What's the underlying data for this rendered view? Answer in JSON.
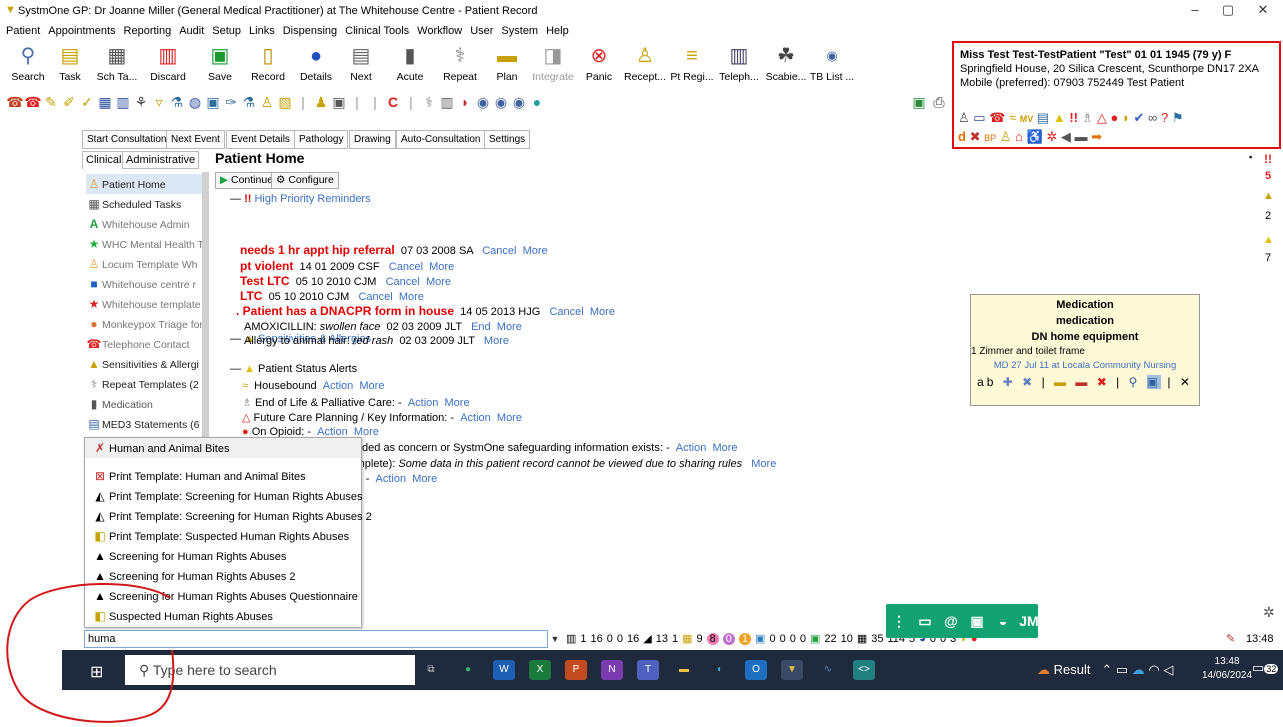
{
  "window": {
    "title": "SystmOne GP: Dr Joanne Miller (General Medical Practitioner) at The Whitehouse Centre - Patient Record"
  },
  "menu": [
    "Patient",
    "Appointments",
    "Reporting",
    "Audit",
    "Setup",
    "Links",
    "Dispensing",
    "Clinical Tools",
    "Workflow",
    "User",
    "System",
    "Help"
  ],
  "toolbar": [
    {
      "label": "Search",
      "icon": "magnifier-icon"
    },
    {
      "label": "Task",
      "icon": "task-icon"
    },
    {
      "label": "Sch Ta...",
      "icon": "scheduled-task-icon"
    },
    {
      "label": "Discard",
      "icon": "trash-icon"
    },
    {
      "label": "Save",
      "icon": "save-icon"
    },
    {
      "label": "Record",
      "icon": "record-icon"
    },
    {
      "label": "Details",
      "icon": "details-icon"
    },
    {
      "label": "Next",
      "icon": "next-icon"
    },
    {
      "label": "Acute",
      "icon": "acute-icon"
    },
    {
      "label": "Repeat",
      "icon": "repeat-icon"
    },
    {
      "label": "Plan",
      "icon": "plan-icon"
    },
    {
      "label": "Integrate",
      "icon": "integrate-icon"
    },
    {
      "label": "Panic",
      "icon": "panic-icon"
    },
    {
      "label": "Recept...",
      "icon": "reception-icon"
    },
    {
      "label": "Pt Regi...",
      "icon": "patient-registration-icon"
    },
    {
      "label": "Teleph...",
      "icon": "telephone-icon"
    },
    {
      "label": "Scabie...",
      "icon": "scabies-icon"
    },
    {
      "label": "TB List ...",
      "icon": "tb-list-icon"
    }
  ],
  "tabs": [
    "Start Consultation",
    "Next Event",
    "Event Details",
    "Pathology",
    "Drawing",
    "Auto-Consultation",
    "Settings"
  ],
  "patient": {
    "name": "Miss Test Test-TestPatient \"Test\" 01 01 1945 (79 y) F",
    "address": "Springfield House, 20 Silica Crescent, Scunthorpe DN17 2XA",
    "mobile": "Mobile (preferred): 07903 752449  Test Patient"
  },
  "left": {
    "tabs": [
      "Clinical",
      "Administrative"
    ],
    "items": [
      "Patient Home",
      "Scheduled Tasks",
      "Whitehouse Admin",
      "WHC Mental Health T",
      "Locum Template Wh",
      "Whitehouse centre r",
      "Whitehouse template",
      "Monkeypox Triage for",
      "Telephone Contact",
      "Sensitivities & Allergi",
      "Repeat Templates (2",
      "Medication",
      "MED3 Statements (6"
    ]
  },
  "home": {
    "title": "Patient Home",
    "continue": "Continue",
    "configure": "Configure"
  },
  "reminders": {
    "header": "High Priority Reminders",
    "rows": [
      {
        "text": "needs 1 hr appt hip referral",
        "meta": "07 03 2008 SA"
      },
      {
        "text": "pt violent",
        "meta": "14 01 2009 CSF"
      },
      {
        "text": "Test LTC",
        "meta": "05 10 2010 CJM"
      },
      {
        "text": "LTC",
        "meta": "05 10 2010 CJM"
      },
      {
        "text": ". Patient has a DNACPR form in house",
        "meta": "14 05 2013 HJG"
      }
    ]
  },
  "links": {
    "cancel": "Cancel",
    "more": "More",
    "end": "End",
    "action": "Action"
  },
  "sens": {
    "header": "Sensitivities & Allergies",
    "r1a": "AMOXICILLIN: ",
    "r1b": "swollen face",
    "r1c": "02 03 2009 JLT",
    "r2a": "Allergy to animal hair: ",
    "r2b": "red rash",
    "r2c": "02 03 2009 JLT"
  },
  "status": {
    "header": "Patient Status Alerts",
    "rows": [
      "Housebound",
      "End of Life & Palliative Care: -",
      "Future Care Planning / Key Information: -",
      "On Opioid: -"
    ],
    "r5": "Coded as concern or SystmOne safeguarding information exists: -",
    "r6a": "complete): ",
    "r6b": "Some data in this patient record cannot be viewed due to sharing rules",
    "r7": "ds: -"
  },
  "med": {
    "l1": "Medication",
    "l2": "medication",
    "l3": "DN home equipment",
    "l4": "1 Zimmer and toilet frame",
    "l5": "MD 27 Jul 11 at Locala Community Nursing"
  },
  "right": {
    "n1": "5",
    "n2": "2",
    "n3": "7"
  },
  "popup": {
    "items": [
      "Human and Animal Bites",
      "Print Template: Human and Animal Bites",
      "Print Template: Screening for Human Rights Abuses",
      "Print Template: Screening for Human Rights Abuses 2",
      "Print Template: Suspected Human Rights Abuses",
      "Screening for Human Rights Abuses",
      "Screening for Human Rights Abuses 2",
      "Screening for Human Rights Abuses Questionnaire",
      "Suspected Human Rights Abuses"
    ]
  },
  "search": {
    "value": "huma"
  },
  "statusbar": {
    "counts": [
      "1",
      "16",
      "0",
      "0",
      "16",
      "13",
      "1",
      "9",
      "8",
      "0",
      "1",
      "0",
      "0",
      "0",
      "0",
      "22",
      "10",
      "35",
      "114",
      "5",
      "0",
      "0",
      "3"
    ],
    "time": "13:48"
  },
  "chat": {
    "initials": "JM"
  },
  "taskbar": {
    "search": "Type here to search",
    "result": "Result",
    "time": "13:48",
    "date": "14/06/2024",
    "badge": "32"
  }
}
